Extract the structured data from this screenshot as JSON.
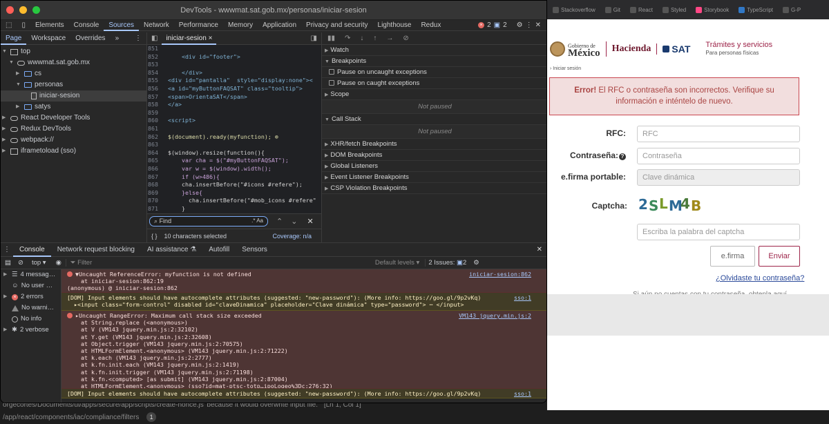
{
  "background": {
    "editor_path": "orgecortes/Documents/ui/apps/secure/app/scripts/create-nonce.js' because it would overwrite input file.",
    "editor_pos": "[Ln 1, Col 1]",
    "status_path": "/app/react/components/iac/compliance/filters",
    "status_badge": "1"
  },
  "browser": {
    "bookmarks": [
      "Stackoverflow",
      "Git",
      "React",
      "Styled",
      "Storybook",
      "TypeScript",
      "G-P"
    ],
    "header": {
      "gob_small": "Gobierno de",
      "gob_big": "México",
      "hacienda": "Hacienda",
      "sat": "SAT",
      "tramites": "Trámites y servicios",
      "tramites_sub": "Para personas físicas"
    },
    "breadcrumb": "› Iniciar sesión",
    "error_strong": "Error!",
    "error_text": " El RFC o contraseña son incorrectos. Verifique su información e inténtelo de nuevo.",
    "form": {
      "rfc_label": "RFC:",
      "rfc_placeholder": "RFC",
      "pass_label": "Contraseña:",
      "pass_placeholder": "Contraseña",
      "efirma_label": "e.firma portable:",
      "efirma_placeholder": "Clave dinámica",
      "captcha_label": "Captcha:",
      "captcha_text": "2SLM4B",
      "captcha_placeholder": "Escriba la palabra del captcha",
      "efirma_button": "e.firma",
      "send_button": "Enviar",
      "forgot": "¿Olvidaste tu contraseña?",
      "cut_text": "Si aún no cuentas con tu contraseña, obtenla aquí"
    }
  },
  "devtools": {
    "title": "DevTools - wwwmat.sat.gob.mx/personas/iniciar-sesion",
    "tabs": [
      "Elements",
      "Console",
      "Sources",
      "Network",
      "Performance",
      "Memory",
      "Application",
      "Privacy and security",
      "Lighthouse",
      "Redux"
    ],
    "active_tab": "Sources",
    "error_count": "2",
    "issue_count": "2",
    "nav_subtabs": [
      "Page",
      "Workspace",
      "Overrides"
    ],
    "tree": [
      {
        "label": "top",
        "depth": 0,
        "icon": "frame-icon",
        "open": true
      },
      {
        "label": "wwwmat.sat.gob.mx",
        "depth": 1,
        "icon": "cloud-icon",
        "open": true
      },
      {
        "label": "cs",
        "depth": 2,
        "icon": "folder-icon",
        "open": false
      },
      {
        "label": "personas",
        "depth": 2,
        "icon": "folder-icon",
        "open": true
      },
      {
        "label": "iniciar-sesion",
        "depth": 3,
        "icon": "file-icon",
        "selected": true
      },
      {
        "label": "satys",
        "depth": 2,
        "icon": "folder-icon",
        "open": false
      },
      {
        "label": "React Developer Tools",
        "depth": 0,
        "icon": "cloud-icon",
        "open": false
      },
      {
        "label": "Redux DevTools",
        "depth": 0,
        "icon": "cloud-icon",
        "open": false
      },
      {
        "label": "webpack://",
        "depth": 0,
        "icon": "cloud-icon",
        "open": false
      },
      {
        "label": "iframetoload (sso)",
        "depth": 0,
        "icon": "frame-icon",
        "open": false
      }
    ],
    "file_tab": "iniciar-sesion",
    "code": [
      {
        "n": "851",
        "t": "                        "
      },
      {
        "n": "852",
        "t": "    <div id=\"footer\">"
      },
      {
        "n": "853",
        "t": ""
      },
      {
        "n": "854",
        "t": "    </div>"
      },
      {
        "n": "855",
        "t": "<div id=\"pantalla\"  style=\"display:none\"><"
      },
      {
        "n": "856",
        "t": "<a id=\"myButtonFAQSAT\" class=\"tooltip\">"
      },
      {
        "n": "857",
        "t": "<span>OrientaSAT</span>"
      },
      {
        "n": "858",
        "t": "</a>"
      },
      {
        "n": "859",
        "t": ""
      },
      {
        "n": "860",
        "t": "<script>"
      },
      {
        "n": "861",
        "t": ""
      },
      {
        "n": "862",
        "t": "$(document).ready(myfunction); ⊗"
      },
      {
        "n": "863",
        "t": ""
      },
      {
        "n": "864",
        "t": "$(window).resize(function(){"
      },
      {
        "n": "865",
        "t": "    var cha = $(\"#myButtonFAQSAT\");"
      },
      {
        "n": "866",
        "t": "    var w = $(window).width();"
      },
      {
        "n": "867",
        "t": "    if (w>486){"
      },
      {
        "n": "868",
        "t": "    cha.insertBefore(\"#icons #refere\");"
      },
      {
        "n": "869",
        "t": "    }else{"
      },
      {
        "n": "870",
        "t": "      cha.insertBefore(\"#mob_icons #refere\""
      },
      {
        "n": "871",
        "t": "    }"
      }
    ],
    "find_placeholder": "Find",
    "find_opts": ".*  Aa",
    "selected_status": "10 characters selected",
    "coverage": "Coverage: n/a",
    "debugger": {
      "watch": "Watch",
      "breakpoints": "Breakpoints",
      "pause_uncaught": "Pause on uncaught exceptions",
      "pause_caught": "Pause on caught exceptions",
      "scope": "Scope",
      "not_paused": "Not paused",
      "call_stack": "Call Stack",
      "sections": [
        "XHR/fetch Breakpoints",
        "DOM Breakpoints",
        "Global Listeners",
        "Event Listener Breakpoints",
        "CSP Violation Breakpoints"
      ]
    },
    "drawer_tabs": [
      "Console",
      "Network request blocking",
      "AI assistance",
      "Autofill",
      "Sensors"
    ],
    "context": "top",
    "filter_placeholder": "Filter",
    "levels": "Default levels",
    "issues": "2 Issues:",
    "issues_badge": "2",
    "sidebar": [
      {
        "label": "4 messag…",
        "icon": "list-icon"
      },
      {
        "label": "No user …",
        "icon": "user-icon"
      },
      {
        "label": "2 errors",
        "icon": "error-icon"
      },
      {
        "label": "No warni…",
        "icon": "warning-icon"
      },
      {
        "label": "No info",
        "icon": "info-icon"
      },
      {
        "label": "2 verbose",
        "icon": "verbose-icon"
      }
    ],
    "messages": [
      {
        "kind": "error",
        "text": "▼Uncaught ReferenceError: myfunction is not defined\n    at iniciar-sesion:862:19\n(anonymous) @ iniciar-sesion:862",
        "link": "iniciar-sesion:862"
      },
      {
        "kind": "warn",
        "text": "[DOM] Input elements should have autocomplete attributes (suggested: \"new-password\"): (More info: https://goo.gl/9p2vKq)\n  ▸<input class=\"form-control\" disabled id=\"claveDinamica\" placeholder=\"Clave dinámica\" type=\"password\"> ⋯ </input>",
        "link": "sso:1"
      },
      {
        "kind": "error",
        "text": "▸Uncaught RangeError: Maximum call stack size exceeded\n    at String.replace (<anonymous>)\n    at V (VM143 jquery.min.js:2:32102)\n    at Y.get (VM143 jquery.min.js:2:32608)\n    at Object.trigger (VM143 jquery.min.js:2:70575)\n    at HTMLFormElement.<anonymous> (VM143 jquery.min.js:2:71222)\n    at k.each (VM143 jquery.min.js:2:2777)\n    at k.fn.init.each (VM143 jquery.min.js:2:1419)\n    at k.fn.init.trigger (VM143 jquery.min.js:2:71198)\n    at k.fn.<computed> [as submit] (VM143 jquery.min.js:2:87004)\n    at HTMLFormElement.<anonymous> (sso?id=mat-ptsc-totp…ipoLogeo%3Dc:276:32)",
        "link": "VM143 jquery.min.js:2"
      },
      {
        "kind": "warn",
        "text": "[DOM] Input elements should have autocomplete attributes (suggested: \"new-password\"): (More info: https://goo.gl/9p2vKq)",
        "link": "sso:1"
      }
    ]
  }
}
